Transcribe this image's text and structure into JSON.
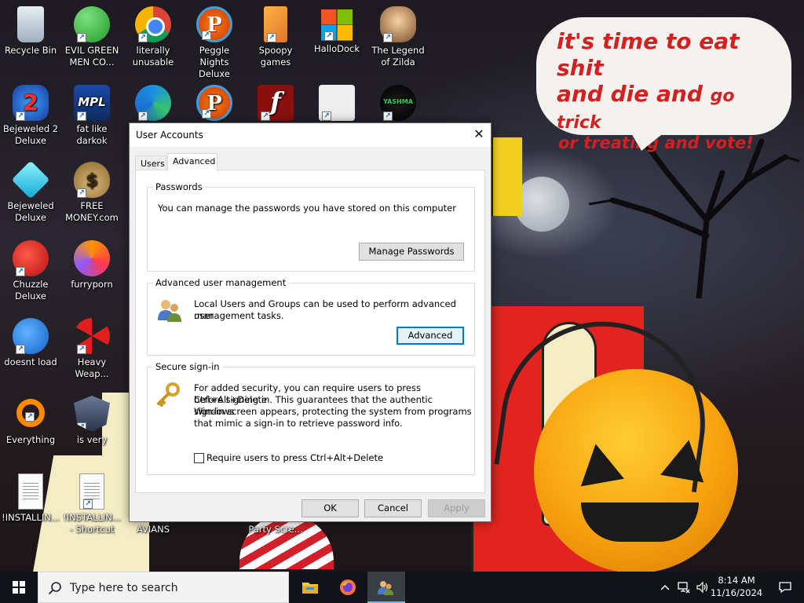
{
  "wallpaper": {
    "bubble_lines": [
      "it's time to eat shit",
      "and die and",
      "go trick",
      "or treating and vote!"
    ]
  },
  "desktop_icons": [
    {
      "label": "Recycle Bin",
      "icon": "recycle-bin-icon"
    },
    {
      "label": "EVIL GREEN MEN CO...",
      "icon": "green-men-icon"
    },
    {
      "label": "literally unusable",
      "icon": "chrome-icon"
    },
    {
      "label": "Peggle Nights Deluxe",
      "icon": "peggle-icon"
    },
    {
      "label": "Spoopy games",
      "icon": "folder-icon"
    },
    {
      "label": "HalloDock",
      "icon": "windows-logo-icon"
    },
    {
      "label": "The Legend of Zilda",
      "icon": "zilda-icon"
    },
    {
      "label": "Bejeweled 2 Deluxe",
      "icon": "bejeweled-2-icon"
    },
    {
      "label": "fat like darkok",
      "icon": "mpl-icon"
    },
    {
      "label": "Bejeweled Deluxe",
      "icon": "diamond-icon"
    },
    {
      "label": "FREE MONEY.com",
      "icon": "money-bag-icon"
    },
    {
      "label": "Chuzzle Deluxe",
      "icon": "chuzzle-icon"
    },
    {
      "label": "furryporn",
      "icon": "firefox-icon"
    },
    {
      "label": "doesnt load",
      "icon": "thunderbird-icon"
    },
    {
      "label": "Heavy Weap...",
      "icon": "radiation-icon"
    },
    {
      "label": "Everything",
      "icon": "everything-icon"
    },
    {
      "label": "is very",
      "icon": "mpl-shield-icon"
    },
    {
      "label": "!INSTALLIN...",
      "icon": "text-document-icon"
    },
    {
      "label": "!INSTALLIN... - Shortcut",
      "icon": "text-document-icon"
    }
  ],
  "partial_labels": {
    "avians": "AVIANS",
    "party": "Party Scre..."
  },
  "dialog": {
    "title": "User Accounts",
    "close_glyph": "✕",
    "tabs": [
      "Users",
      "Advanced"
    ],
    "active_tab": "Advanced",
    "passwords": {
      "title": "Passwords",
      "text": "You can manage the passwords you have stored on this computer",
      "button": "Manage Passwords"
    },
    "advanced_mgmt": {
      "title": "Advanced user management",
      "text_line1": "Local Users and Groups can be used to perform advanced user",
      "text_line2": "management tasks.",
      "button": "Advanced"
    },
    "secure_signin": {
      "title": "Secure sign-in",
      "text_line1": "For added security, you can require users to press Ctrl+Alt+Delete",
      "text_line2": "before signing in. This guarantees that the authentic Windows",
      "text_line3": "sign-in screen appears, protecting the system from programs",
      "text_line4": "that mimic a sign-in to retrieve password info.",
      "checkbox_label": "Require users to press Ctrl+Alt+Delete",
      "checked": false
    },
    "buttons": {
      "ok": "OK",
      "cancel": "Cancel",
      "apply": "Apply"
    }
  },
  "taskbar": {
    "search_placeholder": "Type here to search",
    "pinned": [
      "file-explorer-icon",
      "firefox-icon",
      "user-accounts-icon"
    ],
    "time": "8:14 AM",
    "date": "11/16/2024",
    "tray": [
      "chevron-up-icon",
      "network-icon",
      "volume-icon",
      "notifications-icon"
    ]
  },
  "colors": {
    "accent": "#0078d7",
    "bubble_text": "#d42020",
    "taskbar": "#101418"
  }
}
